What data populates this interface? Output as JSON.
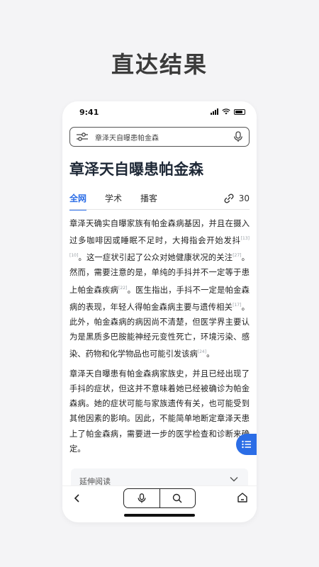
{
  "headline": "直达结果",
  "status": {
    "time": "9:41"
  },
  "search": {
    "query": "章泽天自曝患帕金森"
  },
  "page_title": "章泽天自曝患帕金森",
  "tabs": [
    {
      "label": "全网",
      "active": true
    },
    {
      "label": "学术",
      "active": false
    },
    {
      "label": "播客",
      "active": false
    }
  ],
  "source_count": "30",
  "article": {
    "p1": [
      "章泽天确实自曝家族有帕金森病基因，并且在摄入过多咖啡因或睡眠不足时，大拇指会开始发抖",
      "[13][10]",
      "。这一症状引起了公众对她健康状况的关注",
      "[27]",
      "。然而，需要注意的是，单纯的手抖并不一定等于患上帕金森疾病",
      "[22]",
      "。医生指出，手抖不一定是帕金森病的表现，年轻人得帕金森病主要与遗传相关",
      "[17]",
      "。此外，帕金森病的病因尚不清楚，但医学界主要认为是黑质多巴胺能神经元变性死亡，环境污染、感染、药物和化学物品也可能引发该病",
      "[24]",
      "。"
    ],
    "p2": "章泽天自曝患有帕金森病家族史，并且已经出现了手抖的症状，但这并不意味着她已经被确诊为帕金森病。她的症状可能与家族遗传有关，也可能受到其他因素的影响。因此，不能简单地断定章泽天患上了帕金森病，需要进一步的医学检查和诊断来确定。"
  },
  "extended_reading": "延伸阅读",
  "colors": {
    "accent": "#2b6de6",
    "background": "#f4f4f6"
  },
  "icons": [
    "filter-icon",
    "mic-icon",
    "link-icon",
    "list-icon",
    "chevron-down-icon",
    "back-icon",
    "search-icon",
    "home-icon"
  ]
}
